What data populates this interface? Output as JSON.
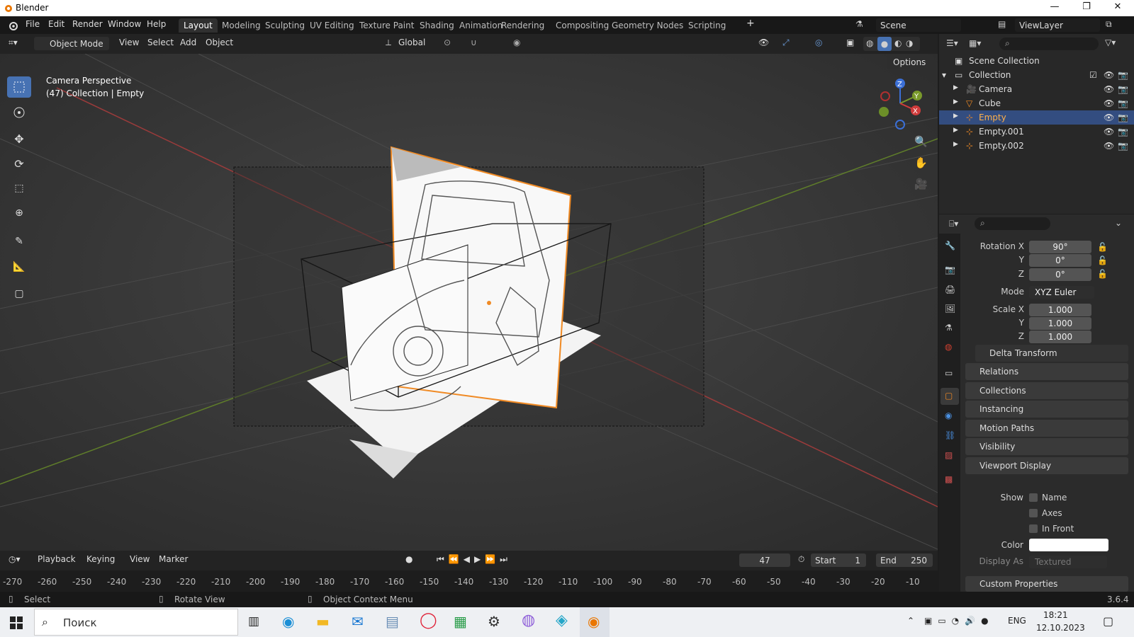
{
  "window": {
    "app_title": "Blender",
    "minimize": "—",
    "maximize": "❐",
    "close": "✕"
  },
  "menu": {
    "file": "File",
    "edit": "Edit",
    "render": "Render",
    "window": "Window",
    "help": "Help"
  },
  "workspaces": [
    {
      "label": "Layout",
      "active": true
    },
    {
      "label": "Modeling"
    },
    {
      "label": "Sculpting"
    },
    {
      "label": "UV Editing"
    },
    {
      "label": "Texture Paint"
    },
    {
      "label": "Shading"
    },
    {
      "label": "Animation"
    },
    {
      "label": "Rendering"
    },
    {
      "label": "Compositing"
    },
    {
      "label": "Geometry Nodes"
    },
    {
      "label": "Scripting"
    }
  ],
  "scene_field": "Scene",
  "viewlayer_field": "ViewLayer",
  "viewport_header": {
    "mode": "Object Mode",
    "view": "View",
    "select": "Select",
    "add": "Add",
    "object": "Object",
    "orientation": "Global",
    "options": "Options"
  },
  "viewport": {
    "camera_label": "Camera Perspective",
    "context_label": "(47) Collection | Empty"
  },
  "outliner": {
    "scene_collection": "Scene Collection",
    "collection": "Collection",
    "items": [
      {
        "label": "Camera"
      },
      {
        "label": "Cube"
      },
      {
        "label": "Empty",
        "selected": true
      },
      {
        "label": "Empty.001"
      },
      {
        "label": "Empty.002"
      }
    ]
  },
  "properties": {
    "rotation_label": "Rotation X",
    "rotation_x": "90°",
    "y_label": "Y",
    "rotation_y": "0°",
    "z_label": "Z",
    "rotation_z": "0°",
    "mode_label": "Mode",
    "mode_value": "XYZ Euler",
    "scale_label": "Scale X",
    "scale_x": "1.000",
    "scale_y": "1.000",
    "scale_z": "1.000",
    "panels": {
      "delta_transform": "Delta Transform",
      "relations": "Relations",
      "collections": "Collections",
      "instancing": "Instancing",
      "motion_paths": "Motion Paths",
      "visibility": "Visibility",
      "viewport_display": "Viewport Display",
      "custom_properties": "Custom Properties"
    },
    "show_label": "Show",
    "name_check": "Name",
    "axes_check": "Axes",
    "infront_check": "In Front",
    "color_label": "Color",
    "color_value": "#ffffff",
    "display_as_label": "Display As",
    "display_as_value": "Textured"
  },
  "timeline": {
    "playback": "Playback",
    "keying": "Keying",
    "view": "View",
    "marker": "Marker",
    "current_frame": "47",
    "start_label": "Start",
    "start_value": "1",
    "end_label": "End",
    "end_value": "250",
    "ruler": [
      "-270",
      "-260",
      "-250",
      "-240",
      "-230",
      "-220",
      "-210",
      "-200",
      "-190",
      "-180",
      "-170",
      "-160",
      "-150",
      "-140",
      "-130",
      "-120",
      "-110",
      "-100",
      "-90",
      "-80",
      "-70",
      "-60",
      "-50",
      "-40",
      "-30",
      "-20",
      "-10"
    ]
  },
  "statusbar": {
    "select": "Select",
    "rotate": "Rotate View",
    "context_menu": "Object Context Menu",
    "version": "3.6.4"
  },
  "taskbar": {
    "search_placeholder": "Поиск",
    "lang": "ENG",
    "time": "18:21",
    "date": "12.10.2023"
  },
  "colors": {
    "accent": "#4772b3",
    "selection_orange": "#f08a24",
    "active_tab": "#303030"
  }
}
